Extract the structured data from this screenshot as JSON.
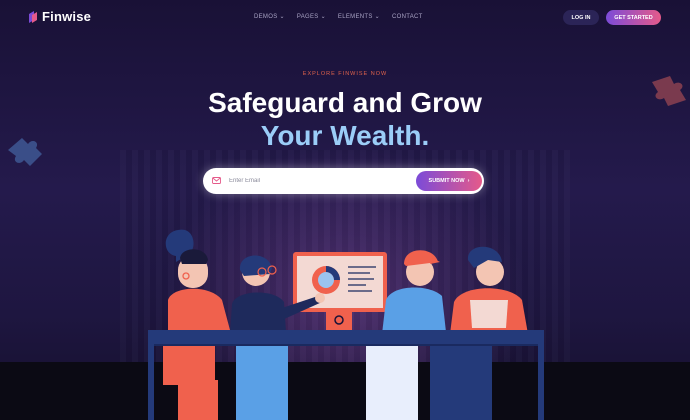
{
  "brand": {
    "name": "Finwise"
  },
  "nav": {
    "items": [
      {
        "label": "DEMOS",
        "dropdown": true
      },
      {
        "label": "PAGES",
        "dropdown": true
      },
      {
        "label": "ELEMENTS",
        "dropdown": true
      },
      {
        "label": "CONTACT",
        "dropdown": false
      }
    ],
    "login_label": "LOG IN",
    "cta_label": "GET STARTED"
  },
  "hero": {
    "eyebrow": "EXPLORE FINWISE NOW",
    "title_line1": "Safeguard and Grow",
    "title_line2": "Your Wealth."
  },
  "subscribe": {
    "placeholder": "Enter Email",
    "value": "",
    "button_label": "SUBMIT NOW",
    "button_icon": "chevron-right-icon"
  },
  "colors": {
    "background": "#1a1238",
    "accent_gradient_start": "#7b4bd8",
    "accent_gradient_end": "#e55a8a",
    "title_highlight": "#9bcdf8",
    "eyebrow": "#e0624b"
  }
}
